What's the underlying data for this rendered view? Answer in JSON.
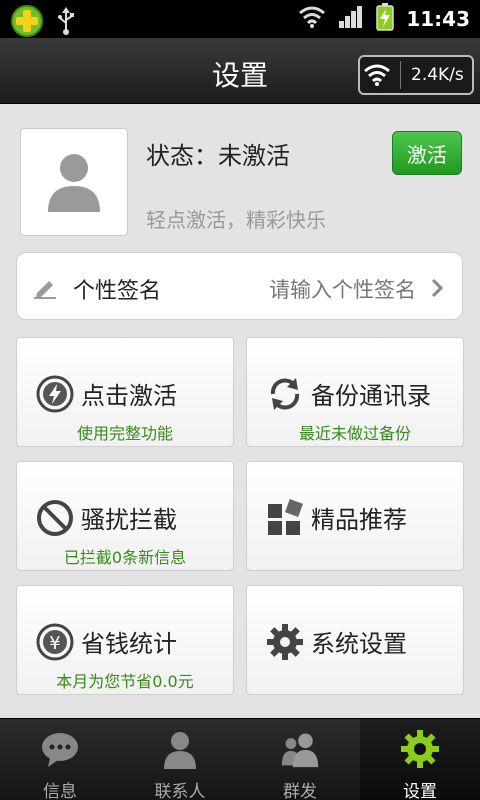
{
  "statusbar": {
    "time": "11:43",
    "icons": [
      "360-security-icon",
      "usb-icon",
      "wifi-icon",
      "signal-icon",
      "battery-charging-icon"
    ]
  },
  "header": {
    "title": "设置",
    "speed": "2.4K/s"
  },
  "profile": {
    "status": "状态：未激活",
    "hint": "轻点激活，精彩快乐",
    "activate_label": "激活"
  },
  "signature": {
    "label": "个性签名",
    "placeholder": "请输入个性签名"
  },
  "tiles": [
    {
      "label": "点击激活",
      "sub": "使用完整功能",
      "icon": "lightning-icon"
    },
    {
      "label": "备份通讯录",
      "sub": "最近未做过备份",
      "icon": "sync-icon"
    },
    {
      "label": "骚扰拦截",
      "sub": "已拦截0条新信息",
      "icon": "block-icon"
    },
    {
      "label": "精品推荐",
      "sub": "",
      "icon": "apps-icon"
    },
    {
      "label": "省钱统计",
      "sub": "本月为您节省0.0元",
      "icon": "yuan-icon"
    },
    {
      "label": "系统设置",
      "sub": "",
      "icon": "gear-icon"
    }
  ],
  "tabs": [
    {
      "label": "信息",
      "icon": "chat-icon",
      "active": false
    },
    {
      "label": "联系人",
      "icon": "contact-icon",
      "active": false
    },
    {
      "label": "群发",
      "icon": "group-icon",
      "active": false
    },
    {
      "label": "设置",
      "icon": "gear-icon",
      "active": true
    }
  ],
  "colors": {
    "accent_green": "#3a8a1c",
    "button_green": "#2fae2f",
    "tab_active_icon": "#8ccc1a"
  }
}
